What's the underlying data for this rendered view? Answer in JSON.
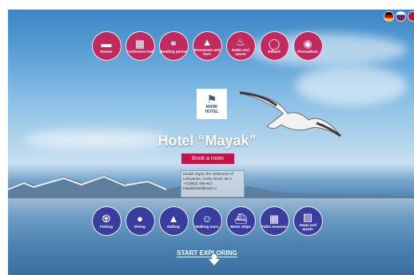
{
  "hotel": {
    "logo_text": "МАЯК",
    "logo_sub": "HOTEL",
    "title": "Hotel “Mayak”",
    "book_label": "Book a room"
  },
  "top_nav": [
    {
      "label": "Rooms",
      "icon": "bed-icon"
    },
    {
      "label": "Conference hall",
      "icon": "conference-icon"
    },
    {
      "label": "Wedding parties",
      "icon": "rings-icon"
    },
    {
      "label": "Restaurant and bars",
      "icon": "cloche-icon"
    },
    {
      "label": "Baths and sauna",
      "icon": "sauna-icon"
    },
    {
      "label": "Billiard",
      "icon": "billiard-ball-icon"
    },
    {
      "label": "Photoalbum",
      "icon": "camera-icon"
    }
  ],
  "bottom_nav": [
    {
      "label": "Fishing",
      "icon": "fish-icon"
    },
    {
      "label": "Diving",
      "icon": "diver-icon"
    },
    {
      "label": "Rafting",
      "icon": "raft-icon"
    },
    {
      "label": "Walking tours",
      "icon": "hiker-icon"
    },
    {
      "label": "Motor ships",
      "icon": "ship-icon"
    },
    {
      "label": "Taltsi museum",
      "icon": "museum-icon"
    },
    {
      "label": "Jeeps and quads",
      "icon": "jeep-icon"
    }
  ],
  "contact": {
    "line1": "Irkutsk region the settlement of",
    "line2": "Listvyanka, Gorky street, 85 A",
    "phone": "+7(3952) 496-910",
    "email": "mayakhotel@mail.ru"
  },
  "explore_label": "START EXPLORING",
  "languages": [
    "de",
    "ru",
    "en"
  ],
  "colors": {
    "accent_top": "#c02a5e",
    "accent_bottom": "#3a3da0",
    "book": "#c0144a"
  }
}
